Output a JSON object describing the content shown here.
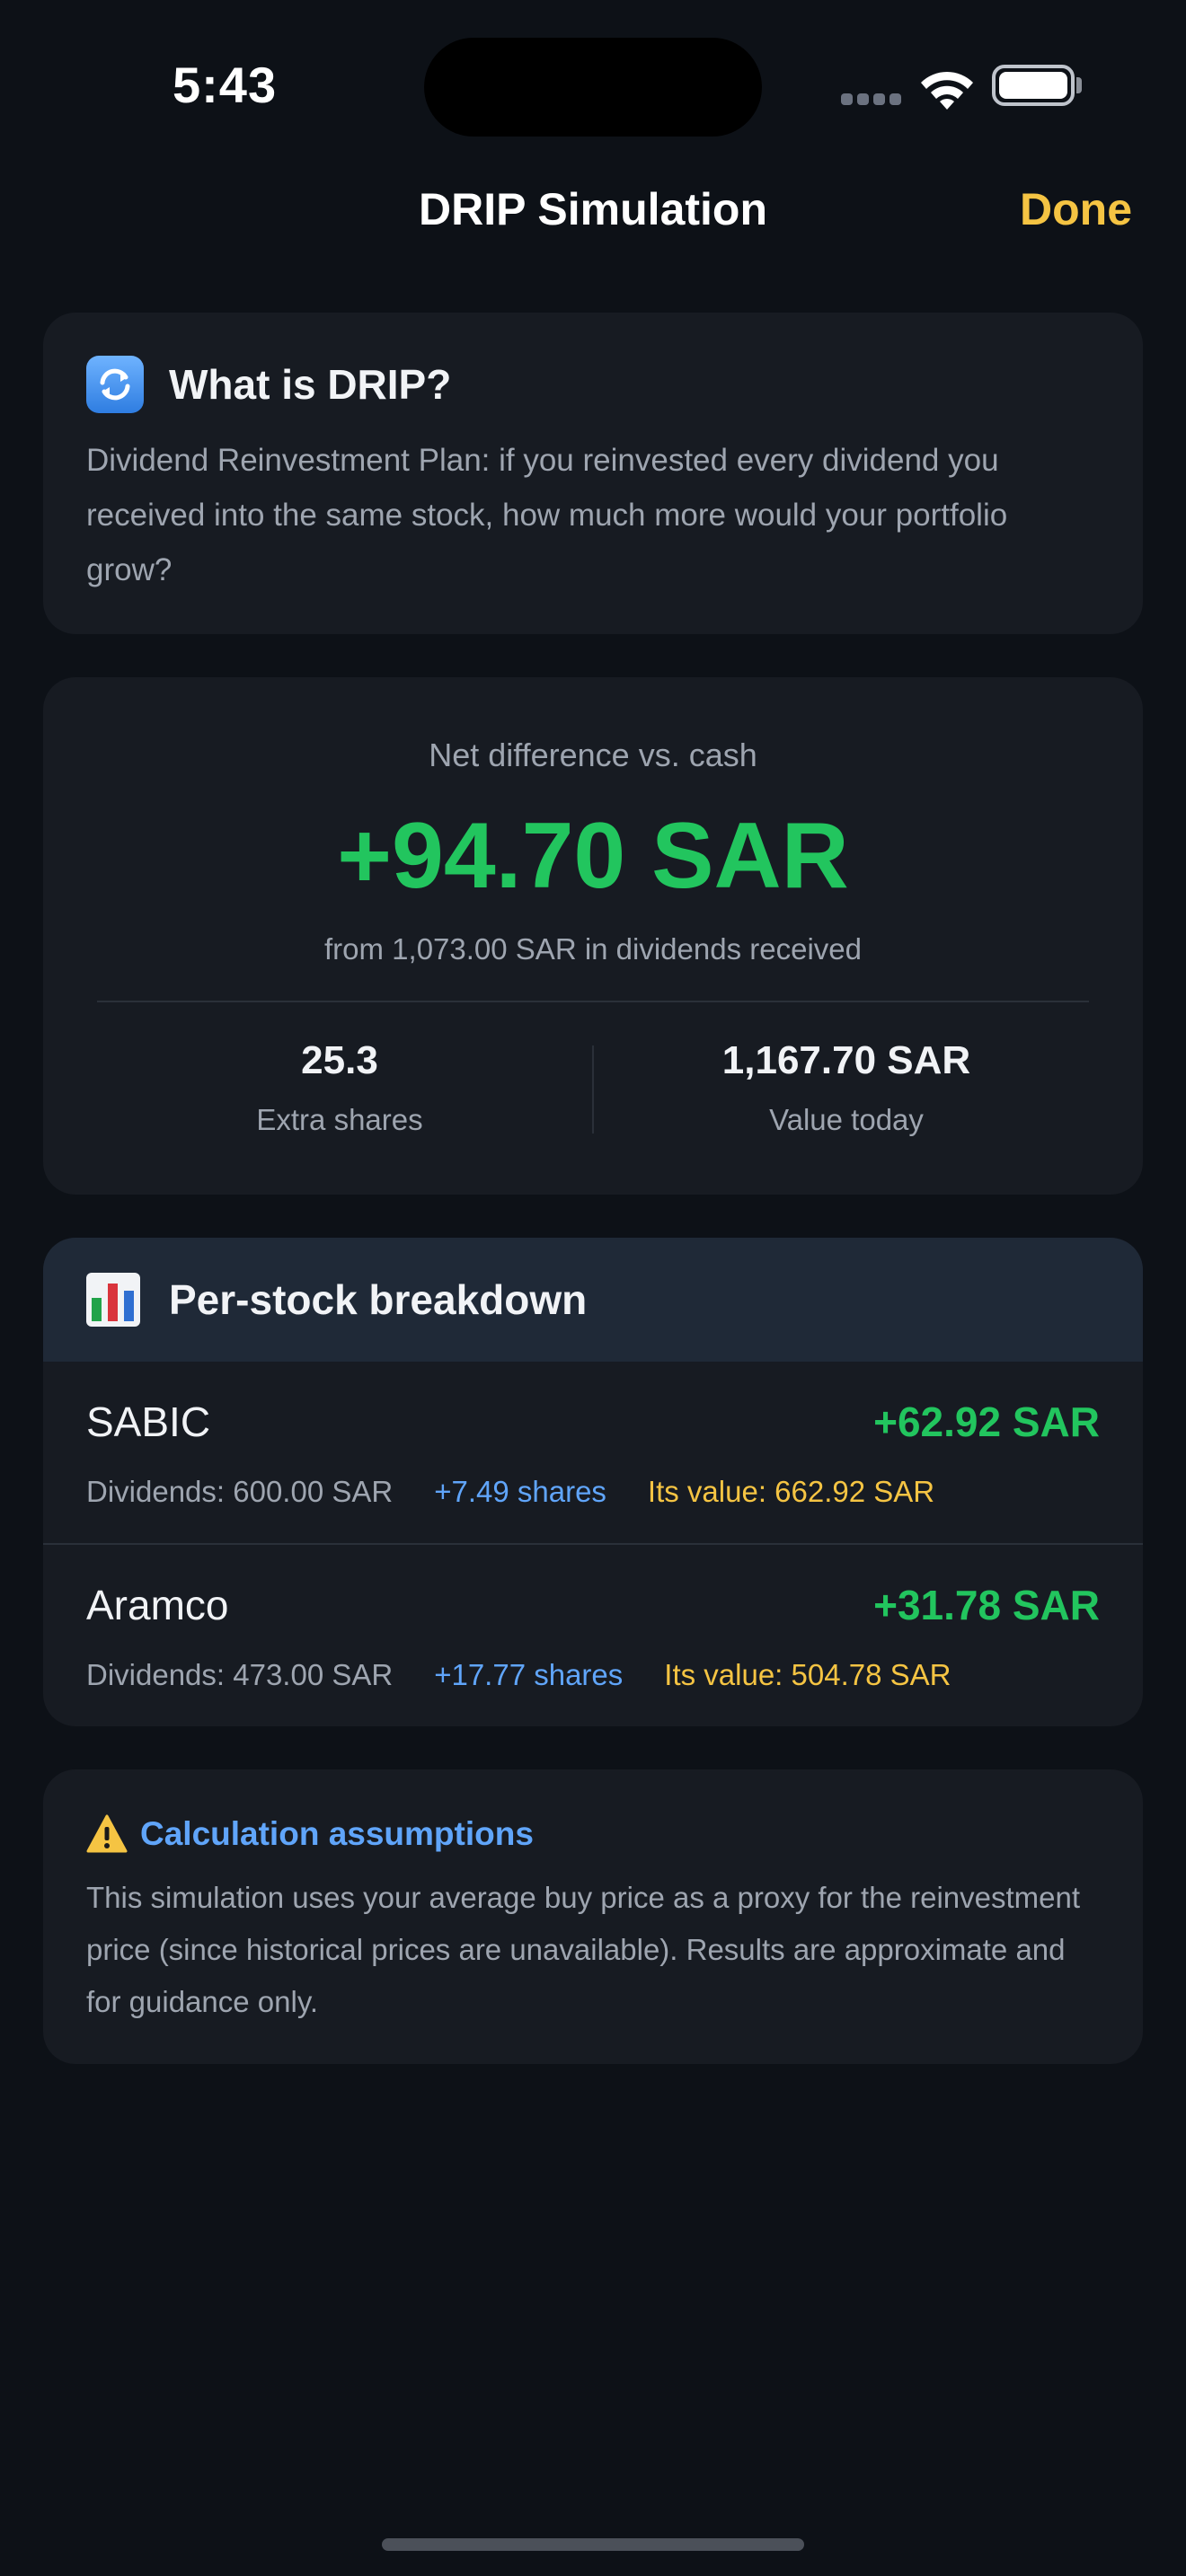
{
  "status_bar": {
    "time": "5:43"
  },
  "nav": {
    "title": "DRIP Simulation",
    "done_label": "Done"
  },
  "info_card": {
    "title": "What is DRIP?",
    "text": "Dividend Reinvestment Plan: if you reinvested every dividend you received into the same stock, how much more would your portfolio grow?"
  },
  "summary": {
    "label": "Net difference vs. cash",
    "value": "+94.70 SAR",
    "subtitle": "from 1,073.00 SAR in dividends received",
    "extra_shares": {
      "value": "25.3",
      "label": "Extra shares"
    },
    "value_today": {
      "value": "1,167.70 SAR",
      "label": "Value today"
    }
  },
  "breakdown": {
    "title": "Per-stock breakdown",
    "rows": [
      {
        "name": "SABIC",
        "gain": "+62.92 SAR",
        "dividends": "Dividends: 600.00 SAR",
        "shares": "+7.49 shares",
        "value": "Its value: 662.92 SAR"
      },
      {
        "name": "Aramco",
        "gain": "+31.78 SAR",
        "dividends": "Dividends: 473.00 SAR",
        "shares": "+17.77 shares",
        "value": "Its value: 504.78 SAR"
      }
    ]
  },
  "assumptions": {
    "title": "Calculation assumptions",
    "text": "This simulation uses your average buy price as a proxy for the reinvestment price (since historical prices are unavailable). Results are approximate and for guidance only."
  },
  "colors": {
    "accent": "#f5c443",
    "positive": "#22c55e",
    "link": "#60a5fa",
    "background": "#0d1117",
    "card": "#171b22"
  }
}
